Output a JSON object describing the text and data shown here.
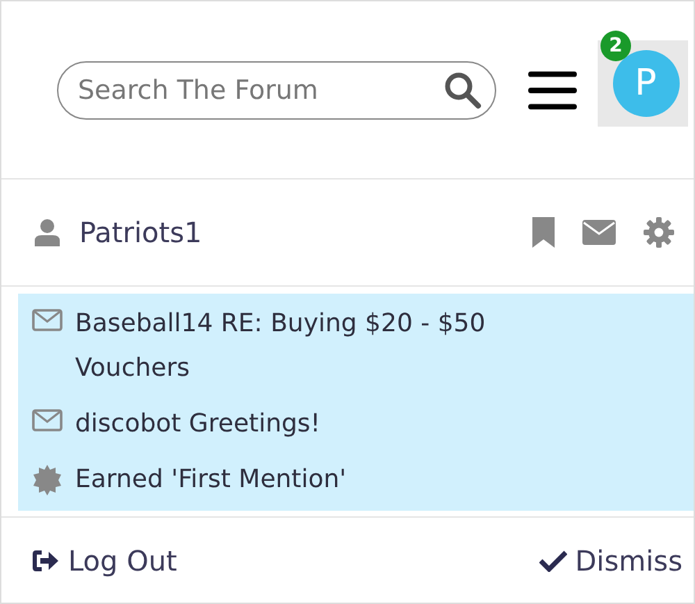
{
  "search": {
    "placeholder": "Search The Forum"
  },
  "avatar": {
    "letter": "P",
    "badge": "2"
  },
  "user": {
    "name": "Patriots1"
  },
  "notifications": [
    {
      "kind": "message",
      "user": "Baseball14",
      "text": "RE: Buying $20 - $50 Vouchers"
    },
    {
      "kind": "message",
      "user": "discobot",
      "text": "Greetings!"
    },
    {
      "kind": "badge",
      "text": "Earned 'First Mention'"
    }
  ],
  "footer": {
    "logout": "Log Out",
    "dismiss": "Dismiss"
  }
}
